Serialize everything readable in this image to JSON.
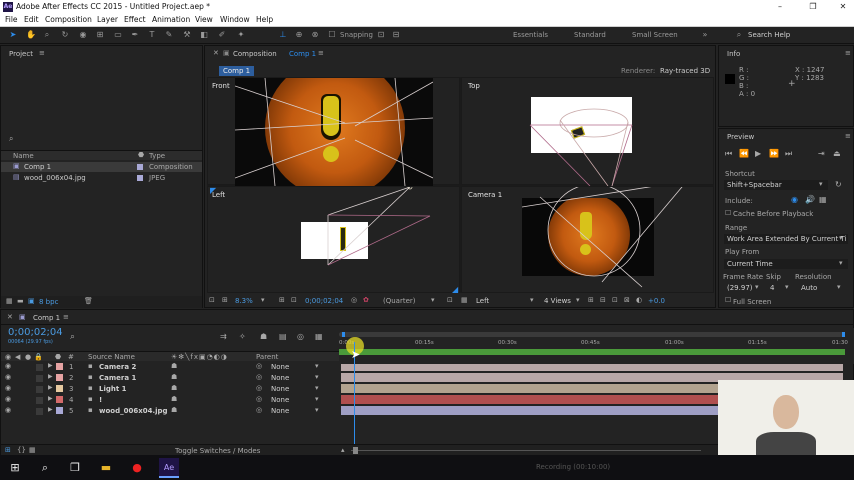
{
  "window": {
    "title": "Adobe After Effects CC 2015 - Untitled Project.aep *",
    "logo": "Ae"
  },
  "window_controls": {
    "minimize": "–",
    "restore": "❐",
    "close": "✕"
  },
  "menu": [
    "File",
    "Edit",
    "Composition",
    "Layer",
    "Effect",
    "Animation",
    "View",
    "Window",
    "Help"
  ],
  "toolbar": {
    "snapping": "Snapping",
    "workspaces": [
      "Essentials",
      "Standard",
      "Small Screen"
    ],
    "search": "Search Help"
  },
  "project": {
    "title": "Project",
    "search_icon": "search-icon",
    "col_name": "Name",
    "col_type": "Type",
    "items": [
      {
        "name": "Comp 1",
        "type": "Composition",
        "icon": "composition-icon",
        "color": "#a9a9d6"
      },
      {
        "name": "wood_006x04.jpg",
        "type": "JPEG",
        "icon": "image-icon",
        "color": "#a9a9d6"
      }
    ],
    "bpc": "8 bpc"
  },
  "composition": {
    "tab_label": "Composition",
    "tab_comp": "Comp 1",
    "sub_tab": "Comp 1",
    "renderer_label": "Renderer:",
    "renderer_value": "Ray-traced 3D",
    "views": [
      "Front",
      "Top",
      "Left",
      "Camera 1"
    ],
    "footer": {
      "zoom": "8.3%",
      "timecode": "0;00;02;04",
      "quality": "(Quarter)",
      "view": "Left",
      "layout": "4 Views",
      "exposure": "+0.0"
    }
  },
  "info": {
    "title": "Info",
    "r": "R :",
    "g": "G :",
    "b": "B :",
    "a": "A : 0",
    "x": "X : 1247",
    "y": "Y : 1283"
  },
  "preview": {
    "title": "Preview",
    "shortcut_label": "Shortcut",
    "shortcut_value": "Shift+Spacebar",
    "include_label": "Include:",
    "cache_label": "Cache Before Playback",
    "range_label": "Range",
    "range_value": "Work Area Extended By Current Ti",
    "play_from_label": "Play From",
    "play_from_value": "Current Time",
    "frame_rate_label": "Frame Rate",
    "skip_label": "Skip",
    "resolution_label": "Resolution",
    "frame_rate_value": "(29.97)",
    "skip_value": "4",
    "resolution_value": "Auto",
    "full_screen": "Full Screen"
  },
  "timeline": {
    "tab": "Comp 1",
    "timecode": "0;00;02;04",
    "fps_info": "00064 (29.97 fps)",
    "col_source": "Source Name",
    "col_parent": "Parent",
    "ruler": [
      "0:00s",
      "00:15s",
      "00:30s",
      "00:45s",
      "01:00s",
      "01:15s",
      "01:30"
    ],
    "layers": [
      {
        "num": "1",
        "name": "Camera 2",
        "color": "#e6a3a3",
        "icon": "camera-icon",
        "parent": "None",
        "bar": "#b8a7a7"
      },
      {
        "num": "2",
        "name": "Camera 1",
        "color": "#e6a3a3",
        "icon": "camera-icon",
        "parent": "None",
        "bar": "#b8a7a7"
      },
      {
        "num": "3",
        "name": "Light 1",
        "color": "#e6c9a0",
        "icon": "light-icon",
        "parent": "None",
        "bar": "#b2a38f"
      },
      {
        "num": "4",
        "name": "!",
        "color": "#d46a6a",
        "icon": "shape-icon",
        "parent": "None",
        "bar": "#b04f4f"
      },
      {
        "num": "5",
        "name": "wood_006x04.jpg",
        "color": "#a9a9d6",
        "icon": "image-icon",
        "parent": "None",
        "bar": "#9e9ec4"
      }
    ],
    "toggle": "Toggle Switches / Modes",
    "work_area": 1.0,
    "playhead": 0.015
  },
  "taskbar": {
    "items": [
      "windows-start-icon",
      "search-icon",
      "task-view-icon",
      "file-explorer-icon",
      "record-icon",
      "after-effects-icon"
    ],
    "ae_label": "Ae",
    "status_text": "Recording (00:10:00)"
  }
}
